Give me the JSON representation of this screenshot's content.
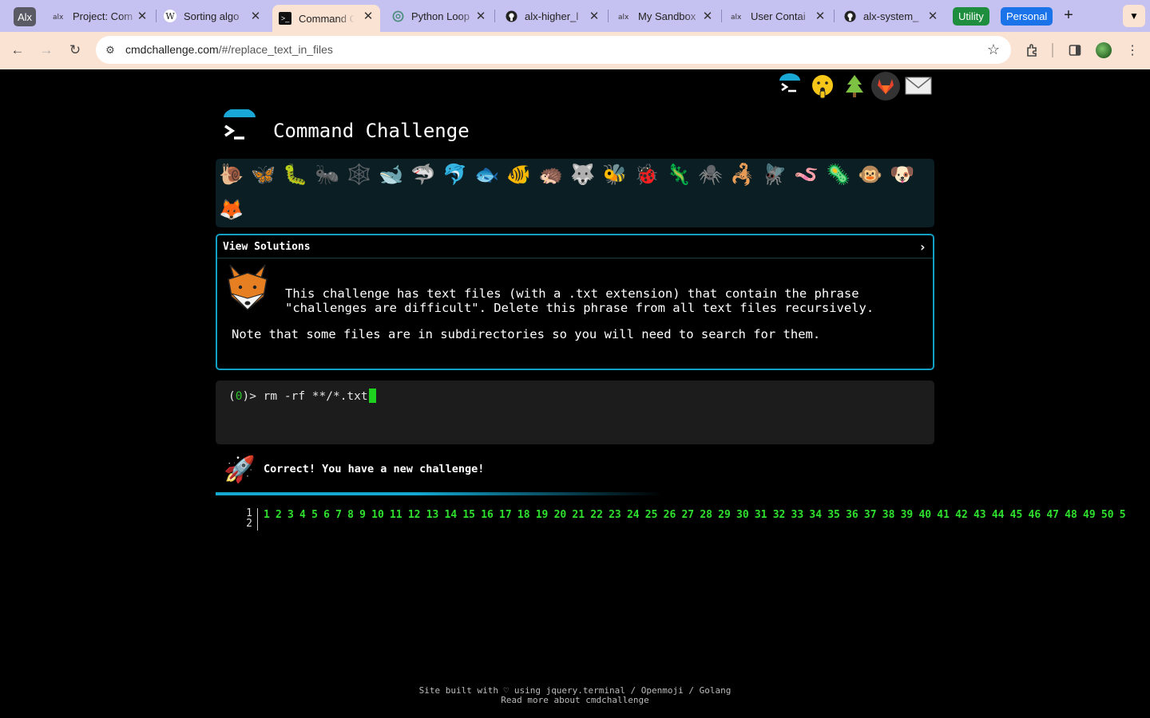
{
  "browser": {
    "profile_chip": "Alx",
    "tabs": [
      {
        "title": "Project: Com",
        "favicon": "alx-icon"
      },
      {
        "title": "Sorting algo",
        "favicon": "wikipedia-icon"
      },
      {
        "title": "Command C",
        "favicon": "terminal-icon"
      },
      {
        "title": "Python Loop",
        "favicon": "chatgpt-icon"
      },
      {
        "title": "alx-higher_l",
        "favicon": "github-icon"
      },
      {
        "title": "My Sandbox",
        "favicon": "alx-icon"
      },
      {
        "title": "User Contai",
        "favicon": "alx-icon"
      },
      {
        "title": "alx-system_",
        "favicon": "github-icon"
      }
    ],
    "groups": [
      {
        "label": "Utility",
        "color": "#1e8e3e"
      },
      {
        "label": "Personal",
        "color": "#1a73e8"
      }
    ],
    "url_host": "cmdchallenge.com",
    "url_path": "/#/replace_text_in_files"
  },
  "site": {
    "title": "Command Challenge",
    "social_icons": [
      "terminal-logo-icon",
      "gitter-face-icon",
      "tree-icon",
      "gitlab-icon",
      "mail-icon"
    ],
    "emoji_row": [
      "🐌",
      "🦋",
      "🐛",
      "🐜",
      "🕸️",
      "🐋",
      "🦈",
      "🐬",
      "🐟",
      "🐠",
      "🦔",
      "🐺",
      "🐝",
      "🐞",
      "🦎",
      "🕷️",
      "🦂",
      "🪰",
      "🪱",
      "🦠",
      "🐵",
      "🐶",
      "🦊"
    ],
    "panel_header": "View Solutions",
    "description_line1": "This challenge has text files (with a .txt extension) that contain the phrase",
    "description_line2": "\"challenges are difficult\". Delete this phrase from all text files recursively.",
    "note": "Note that some files are in subdirectories so you will need to search for them.",
    "terminal_return_code": "0",
    "terminal_command": "rm -rf **/*.txt",
    "result_text": "Correct! You have a new challenge!",
    "line_numbers": [
      "1",
      "2"
    ],
    "levels": [
      "1",
      "2",
      "3",
      "4",
      "5",
      "6",
      "7",
      "8",
      "9",
      "10",
      "11",
      "12",
      "13",
      "14",
      "15",
      "16",
      "17",
      "18",
      "19",
      "20",
      "21",
      "22",
      "23",
      "24",
      "25",
      "26",
      "27",
      "28",
      "29",
      "30",
      "31",
      "32",
      "33",
      "34",
      "35",
      "36",
      "37",
      "38",
      "39",
      "40",
      "41",
      "42",
      "43",
      "44",
      "45",
      "46",
      "47",
      "48",
      "49",
      "50",
      "5"
    ],
    "footer_line1": "Site built with ♡ using jquery.terminal / Openmoji / Golang",
    "footer_line2": "Read more about cmdchallenge"
  }
}
